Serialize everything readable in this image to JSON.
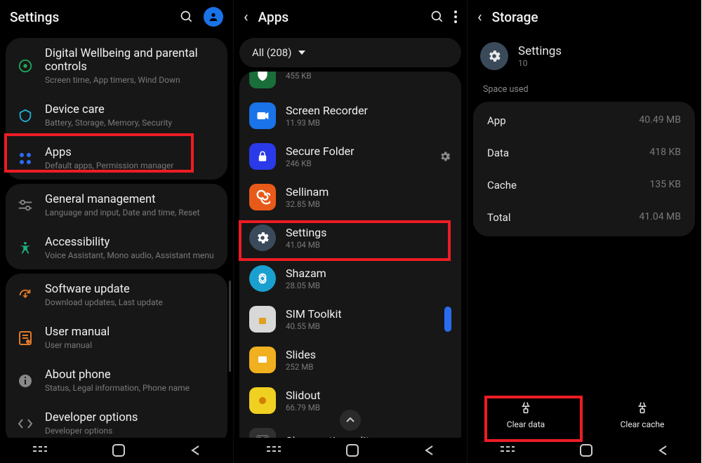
{
  "panel1": {
    "title": "Settings",
    "groups": [
      {
        "rows": [
          {
            "icon": "wellbeing-icon",
            "color": "#1fa85a",
            "label": "Digital Wellbeing and parental controls",
            "sub": "Screen time, App timers, Wind Down"
          },
          {
            "icon": "devicecare-icon",
            "color": "#1fb0d4",
            "label": "Device care",
            "sub": "Battery, Storage, Memory, Security"
          },
          {
            "icon": "apps-icon",
            "color": "#2a6cf0",
            "label": "Apps",
            "sub": "Default apps, Permission manager",
            "highlight": true
          }
        ]
      },
      {
        "rows": [
          {
            "icon": "general-icon",
            "color": "#888888",
            "label": "General management",
            "sub": "Language and input, Date and time, Reset"
          },
          {
            "icon": "accessibility-icon",
            "color": "#20b080",
            "label": "Accessibility",
            "sub": "Voice Assistant, Mono audio, Assistant menu"
          }
        ]
      },
      {
        "rows": [
          {
            "icon": "update-icon",
            "color": "#e07a2a",
            "label": "Software update",
            "sub": "Download updates, Last update"
          },
          {
            "icon": "manual-icon",
            "color": "#e07a2a",
            "label": "User manual",
            "sub": "User manual"
          },
          {
            "icon": "about-icon",
            "color": "#888888",
            "label": "About phone",
            "sub": "Status, Legal information, Phone name"
          },
          {
            "icon": "developer-icon",
            "color": "#888888",
            "label": "Developer options",
            "sub": "Developer options"
          }
        ]
      }
    ]
  },
  "panel2": {
    "title": "Apps",
    "filter": "All (208)",
    "apps": [
      {
        "name": "",
        "size": "455 KB",
        "bg": "#1a6e3a",
        "ic": "shield"
      },
      {
        "name": "Screen Recorder",
        "size": "11.93 MB",
        "bg": "#1a73e8",
        "ic": "camera"
      },
      {
        "name": "Secure Folder",
        "size": "246 KB",
        "bg": "#2a3ae8",
        "ic": "lock",
        "gear": true
      },
      {
        "name": "Sellinam",
        "size": "32.85 MB",
        "bg": "#e85a1a",
        "ic": "spiral"
      },
      {
        "name": "Settings",
        "size": "41.04 MB",
        "bg": "#3a4a5a",
        "ic": "gear",
        "highlight": true
      },
      {
        "name": "Shazam",
        "size": "28.05 MB",
        "bg": "#1aa0d0",
        "ic": "shazam"
      },
      {
        "name": "SIM Toolkit",
        "size": "40.55 MB",
        "bg": "#d8d8d8",
        "ic": "sim",
        "handle": true
      },
      {
        "name": "Slides",
        "size": "252 MB",
        "bg": "#f0b020",
        "ic": "slides"
      },
      {
        "name": "Slidout",
        "size": "66.79 MB",
        "bg": "#f0d020",
        "ic": "slidout"
      },
      {
        "name": "Slow motion editor",
        "size": "",
        "bg": "#303030",
        "ic": "film"
      }
    ]
  },
  "panel3": {
    "title": "Storage",
    "app_name": "Settings",
    "app_version": "10",
    "section": "Space used",
    "rows": [
      {
        "k": "App",
        "v": "40.49 MB"
      },
      {
        "k": "Data",
        "v": "418 KB"
      },
      {
        "k": "Cache",
        "v": "135 KB"
      },
      {
        "k": "Total",
        "v": "41.04 MB"
      }
    ],
    "clear_data": "Clear data",
    "clear_cache": "Clear cache"
  }
}
